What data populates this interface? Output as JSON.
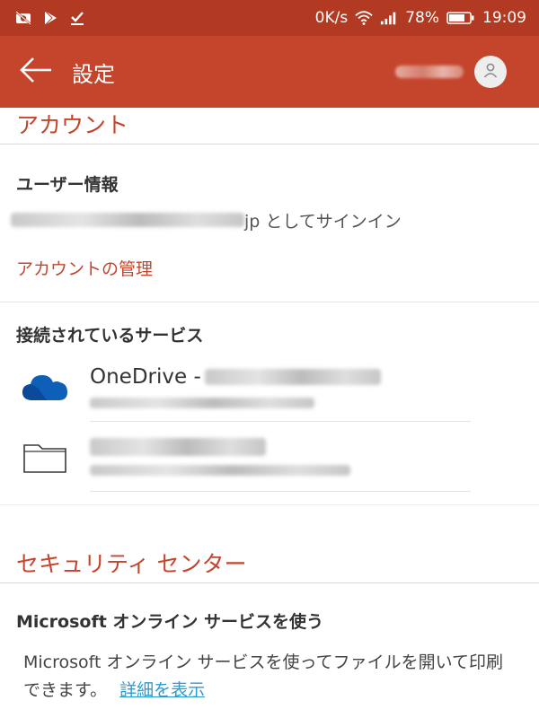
{
  "status_bar": {
    "network_speed": "0K/s",
    "battery": "78%",
    "time": "19:09"
  },
  "app_bar": {
    "title": "設定"
  },
  "account_section": {
    "header": "アカウント",
    "user_info_title": "ユーザー情報",
    "signin_visible_suffix": "jp としてサインイン",
    "manage_account_link": "アカウントの管理",
    "connected_services_title": "接続されているサービス",
    "services": [
      {
        "name_prefix": "OneDrive - ",
        "icon": "onedrive-cloud-icon"
      },
      {
        "name_prefix": "",
        "icon": "folder-icon"
      }
    ]
  },
  "security_section": {
    "header": "セキュリティ センター",
    "ms_services_title": "Microsoft オンライン サービスを使う",
    "ms_services_desc": "Microsoft オンライン サービスを使ってファイルを開いて印刷できます。",
    "details_link": "詳細を表示"
  },
  "colors": {
    "status_bar_bg": "#b23a22",
    "app_bar_bg": "#c5452c",
    "accent_red": "#c5452c",
    "link_blue": "#2b9bd3",
    "onedrive_blue": "#0e5fb7"
  }
}
